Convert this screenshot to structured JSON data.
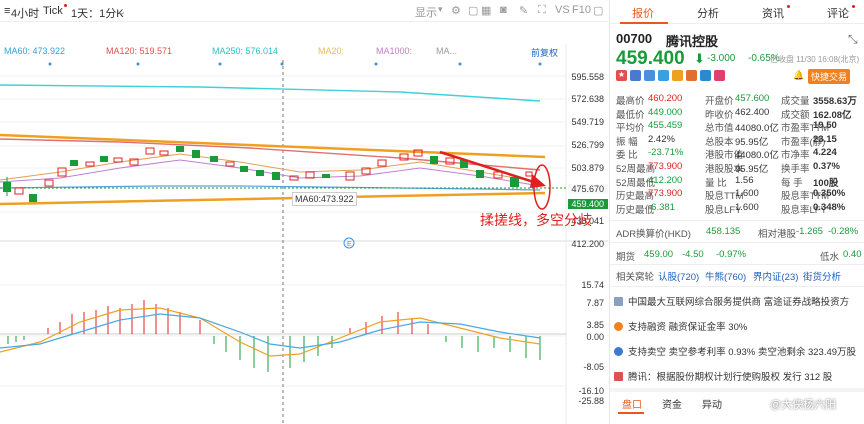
{
  "toolbar": {
    "period_4h": "4小时",
    "tick": "Tick",
    "day_1min": "1天：1分K",
    "display": "显示",
    "vs": "VS",
    "f10": "F10"
  },
  "ma_labels": {
    "ma60": "MA60: 473.922",
    "ma120": "MA120: 519.571",
    "ma250": "MA250: 576.014",
    "ma20": "MA20:",
    "ma1000": "MA1000:",
    "ma_more": "MA...",
    "adjust": "前复权"
  },
  "y_axis_main": [
    "595.558",
    "572.638",
    "549.719",
    "526.799",
    "503.879",
    "475.670",
    "459.400",
    "438.041",
    "412.200"
  ],
  "y_axis_macd": [
    "15.74",
    "7.87",
    "3.85",
    "0.00",
    "-8.05",
    "-16.10",
    "-25.88"
  ],
  "tooltip_ma60": "MA60:473.922",
  "annotation": "揉搓线，多空分歧",
  "watermark": "@大侠杨六阳",
  "colors": {
    "up": "#e02020",
    "down": "#1a9b3a",
    "accent": "#e55a1c",
    "orange_line": "#f0a020"
  },
  "tabs": [
    "报价",
    "分析",
    "资讯",
    "评论"
  ],
  "stock": {
    "code": "00700",
    "name": "腾讯控股",
    "price": "459.400",
    "change": "-3.000",
    "change_pct": "-0.65%",
    "time": "已收盘 11/30 16:08(北京)",
    "quick_trade": "快捷交易"
  },
  "quote_rows": [
    [
      [
        "最高价",
        "460.200",
        "red"
      ],
      [
        "开盘价",
        "457.600",
        "green"
      ],
      [
        "成交量",
        "3558.63万",
        ""
      ]
    ],
    [
      [
        "最低价",
        "449.000",
        "green"
      ],
      [
        "昨收价",
        "462.400",
        ""
      ],
      [
        "成交额",
        "162.08亿",
        ""
      ]
    ],
    [
      [
        "平均价",
        "455.459",
        "green"
      ],
      [
        "总市值",
        "44080.0亿",
        ""
      ],
      [
        "市盈率TTM",
        "19.50",
        ""
      ]
    ],
    [
      [
        "振  幅",
        "2.42%",
        ""
      ],
      [
        "总股本",
        "95.95亿",
        ""
      ],
      [
        "市盈率(静)",
        "23.15",
        ""
      ]
    ],
    [
      [
        "委  比",
        "-23.71%",
        "green"
      ],
      [
        "港股市值",
        "44080.0亿",
        ""
      ],
      [
        "市净率",
        "4.224",
        ""
      ]
    ],
    [
      [
        "52周最高",
        "773.900",
        "red"
      ],
      [
        "港股股本",
        "95.95亿",
        ""
      ],
      [
        "换手率",
        "0.37%",
        ""
      ]
    ],
    [
      [
        "52周最低",
        "412.200",
        "green"
      ],
      [
        "量  比",
        "1.56",
        ""
      ],
      [
        "每  手",
        "100股",
        ""
      ]
    ],
    [
      [
        "历史最高",
        "773.900",
        "red"
      ],
      [
        "股息TTM",
        "1.600",
        ""
      ],
      [
        "股息率TTM",
        "0.350%",
        ""
      ]
    ],
    [
      [
        "历史最低",
        "-6.381",
        "green"
      ],
      [
        "股息LFY",
        "1.600",
        ""
      ],
      [
        "股息率LFY",
        "0.348%",
        ""
      ]
    ]
  ],
  "adr": {
    "label": "ADR换算价(HKD)",
    "value": "458.135",
    "rel_label": "相对港股",
    "rel_change": "-1.265",
    "rel_pct": "-0.28%"
  },
  "futures": {
    "label": "期货",
    "value": "459.00",
    "change": "-4.50",
    "pct": "-0.97%",
    "disc_label": "低水",
    "disc": "0.40"
  },
  "related": {
    "label": "相关窝轮",
    "a": "认股(720)",
    "b": "牛熊(760)",
    "c": "界内证(23)",
    "d": "街货分析"
  },
  "news": [
    "中国最大互联网综合服务提供商 富途证券战略投资方",
    "支持融资  融资保证金率 30%",
    "支持卖空  卖空参考利率 0.93%  卖空池剩余 323.49万股",
    "腾讯：根据股份期权计划行使购股权 发行 312 股"
  ],
  "bottom_tabs": [
    "盘口",
    "资金",
    "异动"
  ]
}
